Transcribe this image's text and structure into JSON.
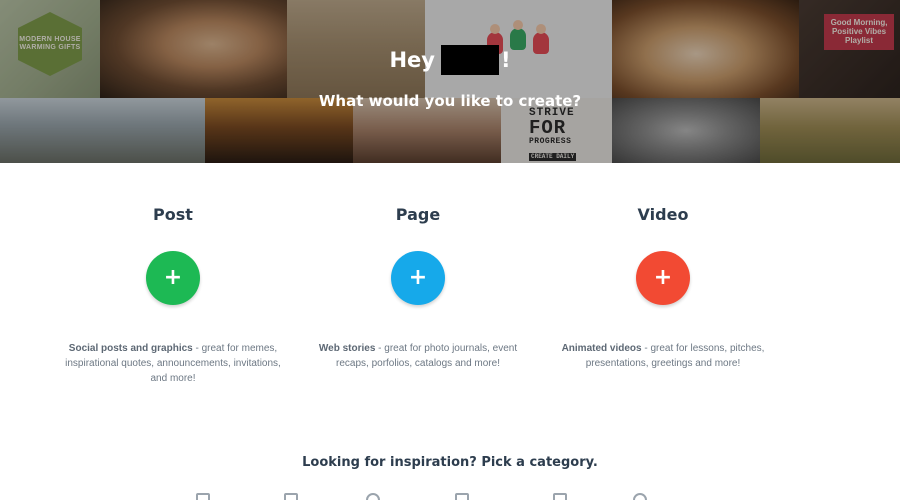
{
  "hero": {
    "greeting": "Hey",
    "greeting_punct": "!",
    "subtitle": "What would you like to create?",
    "tiles": {
      "logo_text": "MODERN HOUSE WARMING GIFTS",
      "quote_text": "Good Morning, Positive Vibes Playlist",
      "strive_1": "STRIVE",
      "strive_2": "FOR",
      "strive_3": "PROGRESS",
      "strive_4": "CREATE DAILY"
    }
  },
  "options": [
    {
      "title": "Post",
      "color": "#1db954",
      "desc_bold": "Social posts and graphics",
      "desc_rest": " - great for memes, inspirational quotes, announcements, invitations, and more!"
    },
    {
      "title": "Page",
      "color": "#16a9ea",
      "desc_bold": "Web stories",
      "desc_rest": " - great for photo journals, event recaps, porfolios, catalogs and more!"
    },
    {
      "title": "Video",
      "color": "#f24a33",
      "desc_bold": "Animated videos",
      "desc_rest": " - great for lessons, pitches, presentations, greetings and more!"
    }
  ],
  "plus_symbol": "+",
  "category": {
    "title": "Looking for inspiration? Pick a category.",
    "icons": [
      "person-icon",
      "grid-icon",
      "globe-icon",
      "chart-icon",
      "graduation-icon",
      "heart-icon"
    ]
  }
}
